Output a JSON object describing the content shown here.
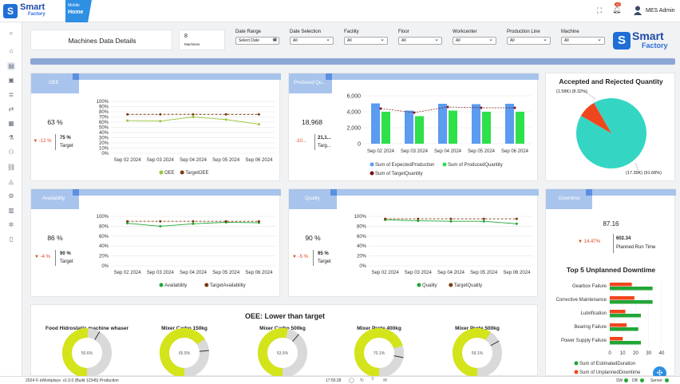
{
  "app": {
    "logo_top": "Smart",
    "logo_bottom": "Factory",
    "home_super": "Mobile",
    "home_label": "Home",
    "user": "MES Admin",
    "notif_count": "99"
  },
  "page": {
    "title": "Machines Data Details",
    "machines_count": "8",
    "machines_label": "Machines"
  },
  "filters": {
    "date_range": {
      "label": "Date Range",
      "value": "Select Date"
    },
    "date_selection": {
      "label": "Date Selection",
      "value": "All"
    },
    "facility": {
      "label": "Facility",
      "value": "All"
    },
    "floor": {
      "label": "Floor",
      "value": "All"
    },
    "workcenter": {
      "label": "Workcenter",
      "value": "All"
    },
    "production_line": {
      "label": "Production Line",
      "value": "All"
    },
    "machine": {
      "label": "Machine",
      "value": "All"
    }
  },
  "oee": {
    "title": "OEE",
    "value": "63 %",
    "delta": "-12 %",
    "target_value": "75 %",
    "target_label": "Target"
  },
  "produced": {
    "title": "Produced Qu...",
    "value": "18,968",
    "delta": "-10...",
    "target_value": "21,1...",
    "target_label": "Targ..."
  },
  "availability": {
    "title": "Availability",
    "value": "86 %",
    "delta": "-4 %",
    "target_value": "90 %",
    "target_label": "Target"
  },
  "quality": {
    "title": "Quality",
    "value": "90 %",
    "delta": "-5 %",
    "target_value": "95 %",
    "target_label": "Target"
  },
  "downtime": {
    "title": "Downtime",
    "value": "87.16",
    "delta": "14.47%",
    "planned_value": "602.34",
    "planned_label": "Planned Run Time"
  },
  "accepted": {
    "title": "Accepted and Rejected Quantity",
    "label_rejected": "(1.58K) (8.32%)",
    "label_accepted": "(17.39K) (91.68%)"
  },
  "top5": {
    "title": "Top 5 Unplanned Downtime"
  },
  "oee_low": {
    "title": "OEE: Lower than target"
  },
  "footer": {
    "copyright": "2024 © eWorkplace. v1.0.0 (Build 12345) Production",
    "time": "17:55:28",
    "sw": "SW",
    "db": "DB",
    "server": "Server"
  },
  "colors": {
    "accent": "#2e8fe3",
    "header": "#a8c4ec",
    "green": "#22a636",
    "red": "#e2431e",
    "teal": "#34d6c3",
    "yellow": "#d4e41a"
  },
  "chart_data": [
    {
      "type": "line",
      "name": "oee",
      "x": [
        "Sep 02 2024",
        "Sep 03 2024",
        "Sep 04 2024",
        "Sep 05 2024",
        "Sep 06 2024"
      ],
      "series": [
        {
          "name": "OEE",
          "values": [
            63,
            62,
            70,
            65,
            56
          ],
          "color": "#9ac53b"
        },
        {
          "name": "TargetOEE",
          "values": [
            75,
            75,
            75,
            75,
            75
          ],
          "color": "#7a3b12"
        }
      ],
      "yticks": [
        "0%",
        "10%",
        "20%",
        "30%",
        "40%",
        "50%",
        "60%",
        "70%",
        "80%",
        "90%",
        "100%"
      ],
      "ylim": [
        0,
        100
      ]
    },
    {
      "type": "bar",
      "name": "produced",
      "categories": [
        "Sep 02 2024",
        "Sep 03 2024",
        "Sep 04 2024",
        "Sep 05 2024",
        "Sep 06 2024"
      ],
      "series": [
        {
          "name": "Sum of ExpectedProduction",
          "values": [
            5050,
            4150,
            5000,
            4950,
            5000
          ],
          "color": "#5b9bf0"
        },
        {
          "name": "Sum of ProducedQuantity",
          "values": [
            4000,
            3450,
            4150,
            4000,
            4000
          ],
          "color": "#2ee04a"
        },
        {
          "name": "Sum of TargetQuantity",
          "values": [
            4400,
            3900,
            4600,
            4500,
            4500
          ],
          "color": "#7a1212"
        }
      ],
      "yticks": [
        "0",
        "2,000",
        "4,000",
        "6,000"
      ],
      "ylim": [
        0,
        6000
      ]
    },
    {
      "type": "line",
      "name": "availability",
      "x": [
        "Sep 02 2024",
        "Sep 03 2024",
        "Sep 04 2024",
        "Sep 05 2024",
        "Sep 06 2024"
      ],
      "series": [
        {
          "name": "Availability",
          "values": [
            86,
            80,
            85,
            88,
            87
          ],
          "color": "#22a636"
        },
        {
          "name": "TargetAvailability",
          "values": [
            90,
            90,
            90,
            90,
            90
          ],
          "color": "#7a3b12"
        }
      ],
      "yticks": [
        "0%",
        "20%",
        "40%",
        "60%",
        "80%",
        "100%"
      ],
      "ylim": [
        0,
        100
      ]
    },
    {
      "type": "line",
      "name": "quality",
      "x": [
        "Sep 02 2024",
        "Sep 03 2024",
        "Sep 04 2024",
        "Sep 05 2024",
        "Sep 06 2024"
      ],
      "series": [
        {
          "name": "Quality",
          "values": [
            93,
            91,
            90,
            90,
            85
          ],
          "color": "#22a636"
        },
        {
          "name": "TargetQuality",
          "values": [
            95,
            95,
            95,
            95,
            95
          ],
          "color": "#7a3b12"
        }
      ],
      "yticks": [
        "0%",
        "20%",
        "40%",
        "60%",
        "80%",
        "100%"
      ],
      "ylim": [
        0,
        100
      ]
    },
    {
      "type": "pie",
      "name": "accepted",
      "slices": [
        {
          "label": "Accepted",
          "value": 91.68,
          "color": "#34d6c3"
        },
        {
          "label": "Rejected",
          "value": 8.32,
          "color": "#f0461e"
        }
      ]
    },
    {
      "type": "bar",
      "name": "top5",
      "orientation": "horizontal",
      "categories": [
        "Gearbox Failure",
        "Corrective Maintenance",
        "Lubrification",
        "Bearing Failure",
        "Power Supply Failure"
      ],
      "series": [
        {
          "name": "Sum of EstimatedDuration",
          "values": [
            33,
            33,
            24,
            22,
            24
          ],
          "color": "#22a636"
        },
        {
          "name": "Sum of UnplannedDowntime",
          "values": [
            17,
            19,
            12,
            13,
            10
          ],
          "color": "#f0461e"
        }
      ],
      "xticks": [
        "0",
        "10",
        "20",
        "30",
        "40"
      ],
      "xlim": [
        0,
        40
      ]
    },
    {
      "type": "gauge",
      "name": "gauges",
      "items": [
        {
          "label": "Food Hidrostatic machine whaser",
          "value": 50.6
        },
        {
          "label": "Mixer Carbo 150kg",
          "value": 65.5
        },
        {
          "label": "Mixer Carbo 500kg",
          "value": 53.5
        },
        {
          "label": "Mixer Prote 400kg",
          "value": 70.1
        },
        {
          "label": "Mixer Prote 500kg",
          "value": 59.1
        }
      ]
    }
  ]
}
